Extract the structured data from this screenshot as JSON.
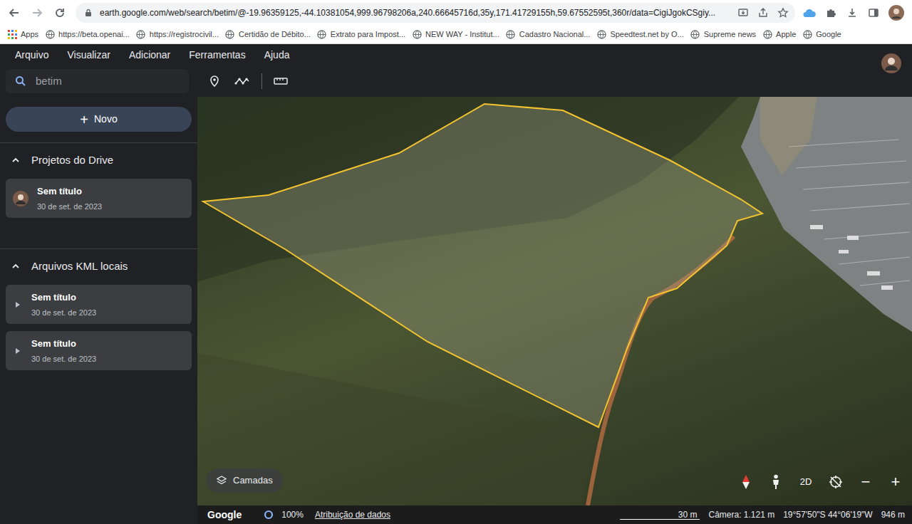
{
  "browser": {
    "url": "earth.google.com/web/search/betim/@-19.96359125,-44.10381054,999.96798206a,240.66645716d,35y,171.41729155h,59.67552595t,360r/data=CigiJgokCSgiy...",
    "bookmarks": [
      {
        "label": "Apps",
        "kind": "apps"
      },
      {
        "label": "https://beta.openai...",
        "kind": "site"
      },
      {
        "label": "https://registrocivil...",
        "kind": "site"
      },
      {
        "label": "Certidão de Débito...",
        "kind": "site"
      },
      {
        "label": "Extrato para Impost...",
        "kind": "site"
      },
      {
        "label": "NEW WAY - Institut...",
        "kind": "site"
      },
      {
        "label": "Cadastro Nacional...",
        "kind": "site"
      },
      {
        "label": "Speedtest.net by O...",
        "kind": "site"
      },
      {
        "label": "Supreme news",
        "kind": "site"
      },
      {
        "label": "Apple",
        "kind": "site"
      },
      {
        "label": "Google",
        "kind": "site"
      }
    ]
  },
  "app": {
    "menu": [
      "Arquivo",
      "Visualizar",
      "Adicionar",
      "Ferramentas",
      "Ajuda"
    ],
    "search": {
      "value": "betim"
    },
    "sidebar": {
      "new_button": {
        "icon": "+",
        "label": "Novo"
      },
      "sections": [
        {
          "title": "Projetos do Drive",
          "expanded": true,
          "items": [
            {
              "kind": "drive",
              "title": "Sem título",
              "date": "30 de set. de 2023"
            }
          ]
        },
        {
          "title": "Arquivos KML locais",
          "expanded": true,
          "items": [
            {
              "kind": "kml",
              "title": "Sem título",
              "date": "30 de set. de 2023"
            },
            {
              "kind": "kml",
              "title": "Sem título",
              "date": "30 de set. de 2023"
            }
          ]
        }
      ]
    },
    "map": {
      "layers_button": "Camadas",
      "view_toggle": "2D",
      "zoom_out": "−",
      "zoom_in": "+"
    },
    "status_bar": {
      "logo": "Google",
      "loading": "100%",
      "attribution": "Atribuição de dados",
      "scale": "30 m",
      "camera": "Câmera: 1.121 m",
      "coordinates": "19°57'50\"S 44°06'19\"W",
      "altitude": "946 m"
    }
  }
}
